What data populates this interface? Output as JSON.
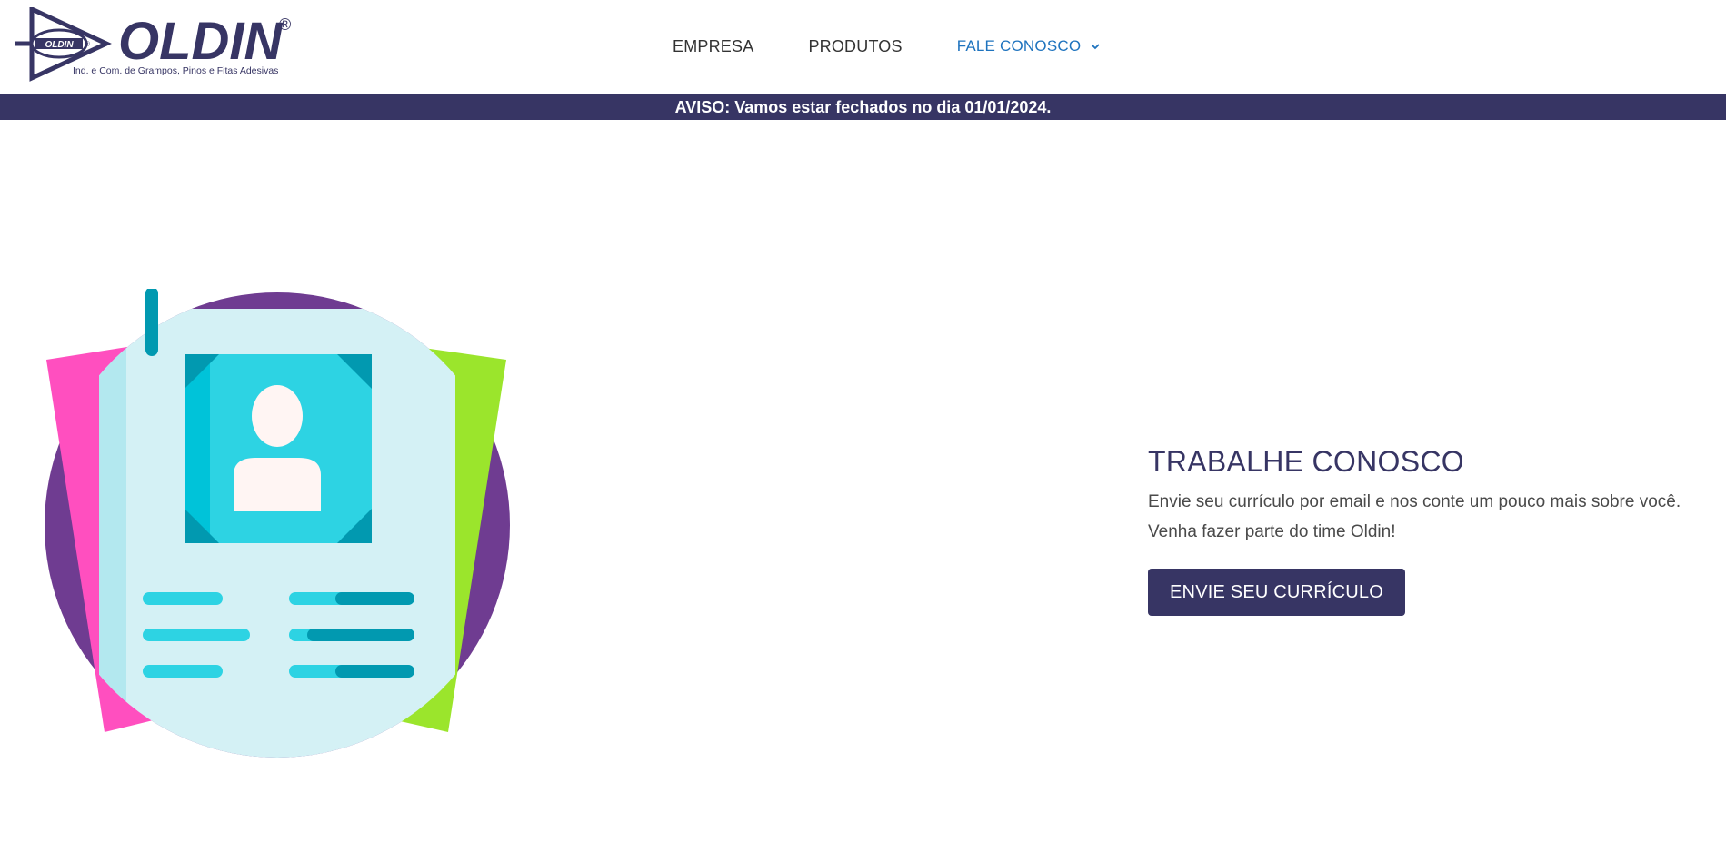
{
  "brand": {
    "name": "OLDIN",
    "tagline": "Ind. e Com. de Grampos, Pinos e Fitas Adesivas",
    "registered": "®",
    "badge_text": "OLDIN"
  },
  "nav": {
    "items": [
      {
        "label": "EMPRESA"
      },
      {
        "label": "PRODUTOS"
      },
      {
        "label": "FALE CONOSCO"
      }
    ]
  },
  "notice": {
    "text": "AVISO: Vamos estar fechados no dia 01/01/2024."
  },
  "careers": {
    "title": "TRABALHE CONOSCO",
    "lines": [
      "Envie seu currículo por email e nos conte um pouco mais sobre você.",
      "Venha fazer parte do time Oldin!"
    ],
    "button_label": "ENVIE SEU CURRÍCULO"
  },
  "illustration": {
    "icon": "resume-icon",
    "colors": {
      "circle": "#6f3c91",
      "paper_left": "#ff4fbf",
      "paper_right": "#9be52c",
      "document": "#d4f1f5",
      "document_edge": "#b3e8ef",
      "photo": "#2dd3e3",
      "photo_dark": "#0199b0",
      "avatar": "#fff5f3"
    }
  },
  "colors": {
    "brand_navy": "#373564",
    "link_blue": "#1e73be"
  }
}
